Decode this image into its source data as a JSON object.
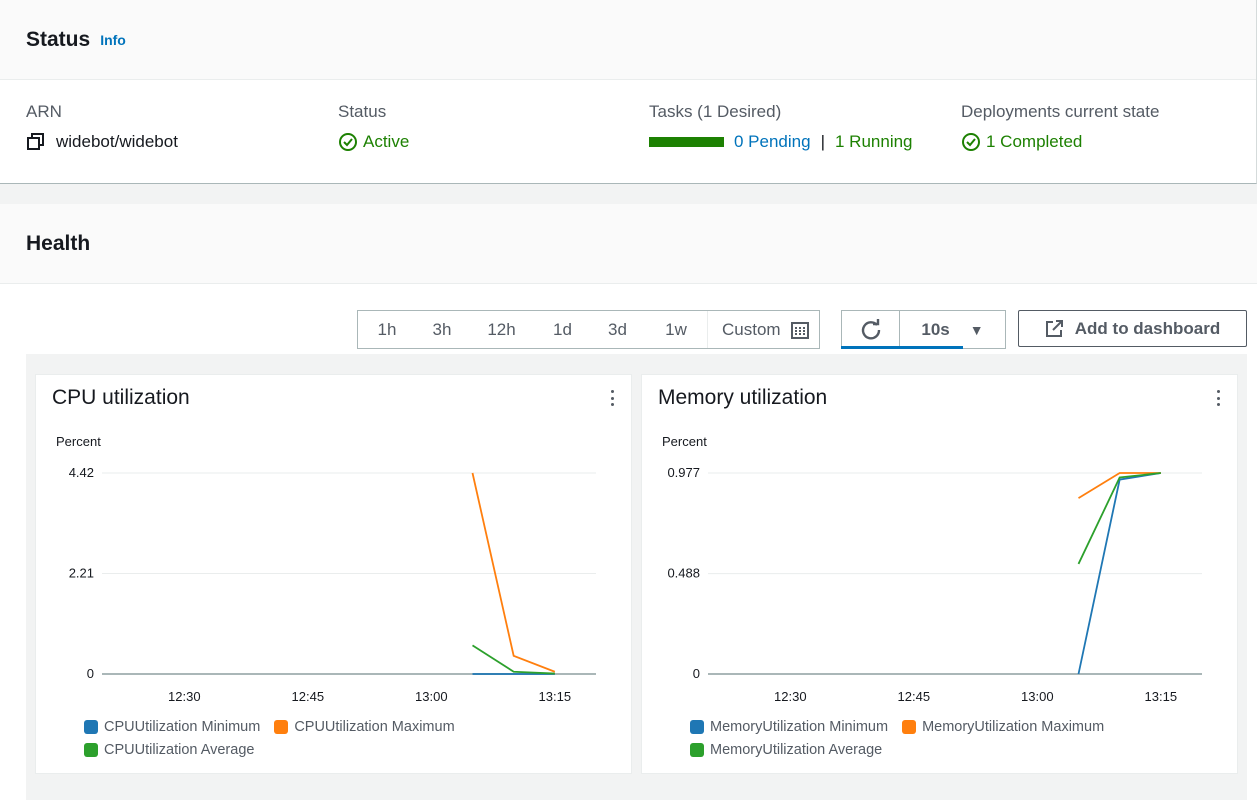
{
  "status_panel": {
    "title": "Status",
    "info": "Info",
    "arn_label": "ARN",
    "arn_value": "widebot/widebot",
    "status_label": "Status",
    "status_value": "Active",
    "tasks_label": "Tasks (1 Desired)",
    "tasks_pending": "0 Pending",
    "tasks_separator": "|",
    "tasks_running": "1 Running",
    "deploy_label": "Deployments current state",
    "deploy_value": "1 Completed"
  },
  "health_panel": {
    "title": "Health",
    "ranges": [
      "1h",
      "3h",
      "12h",
      "1d",
      "3d",
      "1w"
    ],
    "custom_label": "Custom",
    "interval": "10s",
    "add_dashboard": "Add to dashboard"
  },
  "colors": {
    "minimum": "#1f77b4",
    "maximum": "#ff7f0e",
    "average": "#2ca02c",
    "green_status": "#1d8102",
    "link": "#0073bb"
  },
  "chart_data": [
    {
      "type": "line",
      "title": "CPU utilization",
      "ylabel": "Percent",
      "ylim": [
        0,
        4.42
      ],
      "yticks": [
        "4.42",
        "2.21",
        "0"
      ],
      "xticks": [
        "12:30",
        "12:45",
        "13:00",
        "13:15"
      ],
      "grid": true,
      "legend_placement": "bottom",
      "series": [
        {
          "name": "CPUUtilization Minimum",
          "color": "#1f77b4",
          "points": [
            [
              "13:05",
              0
            ],
            [
              "13:10",
              0
            ],
            [
              "13:15",
              0
            ]
          ]
        },
        {
          "name": "CPUUtilization Maximum",
          "color": "#ff7f0e",
          "points": [
            [
              "13:05",
              4.42
            ],
            [
              "13:10",
              0.4
            ],
            [
              "13:15",
              0.05
            ]
          ]
        },
        {
          "name": "CPUUtilization Average",
          "color": "#2ca02c",
          "points": [
            [
              "13:05",
              0.63
            ],
            [
              "13:10",
              0.05
            ],
            [
              "13:15",
              0.01
            ]
          ]
        }
      ]
    },
    {
      "type": "line",
      "title": "Memory utilization",
      "ylabel": "Percent",
      "ylim": [
        0,
        0.977
      ],
      "yticks": [
        "0.977",
        "0.488",
        "0"
      ],
      "xticks": [
        "12:30",
        "12:45",
        "13:00",
        "13:15"
      ],
      "grid": true,
      "legend_placement": "bottom",
      "series": [
        {
          "name": "MemoryUtilization Minimum",
          "color": "#1f77b4",
          "points": [
            [
              "13:05",
              0
            ],
            [
              "13:10",
              0.945
            ],
            [
              "13:15",
              0.977
            ]
          ]
        },
        {
          "name": "MemoryUtilization Maximum",
          "color": "#ff7f0e",
          "points": [
            [
              "13:05",
              0.855
            ],
            [
              "13:10",
              0.977
            ],
            [
              "13:15",
              0.977
            ]
          ]
        },
        {
          "name": "MemoryUtilization Average",
          "color": "#2ca02c",
          "points": [
            [
              "13:05",
              0.535
            ],
            [
              "13:10",
              0.955
            ],
            [
              "13:15",
              0.977
            ]
          ]
        }
      ]
    }
  ]
}
